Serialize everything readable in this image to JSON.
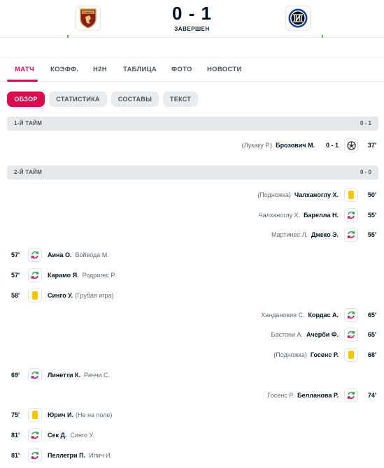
{
  "header": {
    "score": "0 - 1",
    "status": "ЗАВЕРШЕН",
    "home_logo_text": "TORINO"
  },
  "tabs": [
    {
      "label": "МАТЧ",
      "active": true
    },
    {
      "label": "КОЭФФ.",
      "active": false
    },
    {
      "label": "H2H",
      "active": false
    },
    {
      "label": "ТАБЛИЦА",
      "active": false
    },
    {
      "label": "ФОТО",
      "active": false
    },
    {
      "label": "НОВОСТИ",
      "active": false
    }
  ],
  "subtabs": [
    {
      "label": "ОБЗОР",
      "active": true
    },
    {
      "label": "СТАТИСТИКА",
      "active": false
    },
    {
      "label": "СОСТАВЫ",
      "active": false
    },
    {
      "label": "ТЕКСТ",
      "active": false
    }
  ],
  "sections": [
    {
      "title": "1-Й ТАЙМ",
      "score": "0 - 1"
    },
    {
      "title": "2-Й ТАЙМ",
      "score": "0 - 0"
    }
  ],
  "events": [
    {
      "side": "away",
      "minute": "37'",
      "type": "goal",
      "player": "Брозович М.",
      "secondary": "(Лукаку Р.)",
      "score": "0 - 1"
    },
    {
      "side": "away",
      "minute": "50'",
      "type": "yellow",
      "player": "Чалханоглу Х.",
      "secondary": "(Подножка)"
    },
    {
      "side": "away",
      "minute": "55'",
      "type": "sub",
      "player": "Барелла Н.",
      "secondary": "Чалханоглу Х."
    },
    {
      "side": "away",
      "minute": "55'",
      "type": "sub",
      "player": "Джеко Э.",
      "secondary": "Мартинес Л."
    },
    {
      "side": "home",
      "minute": "57'",
      "type": "sub",
      "player": "Аина О.",
      "secondary": "Войвода М."
    },
    {
      "side": "home",
      "minute": "57'",
      "type": "sub",
      "player": "Карамо Я.",
      "secondary": "Родригес Р."
    },
    {
      "side": "home",
      "minute": "58'",
      "type": "yellow",
      "player": "Синго У.",
      "secondary": "(Грубая игра)"
    },
    {
      "side": "away",
      "minute": "65'",
      "type": "sub",
      "player": "Кордас А.",
      "secondary": "Хандановия С."
    },
    {
      "side": "away",
      "minute": "65'",
      "type": "sub",
      "player": "Ачерби Ф.",
      "secondary": "Бастони А."
    },
    {
      "side": "away",
      "minute": "68'",
      "type": "yellow",
      "player": "Госенс Р.",
      "secondary": "(Подножка)"
    },
    {
      "side": "home",
      "minute": "69'",
      "type": "sub",
      "player": "Линетти К.",
      "secondary": "Риччи С."
    },
    {
      "side": "away",
      "minute": "74'",
      "type": "sub",
      "player": "Белланова Р.",
      "secondary": "Госенс Р."
    },
    {
      "side": "home",
      "minute": "75'",
      "type": "yellow",
      "player": "Юрич И.",
      "secondary": "(Не на поле)"
    },
    {
      "side": "home",
      "minute": "81'",
      "type": "sub",
      "player": "Сек Д.",
      "secondary": "Синго У."
    },
    {
      "side": "home",
      "minute": "81'",
      "type": "sub",
      "player": "Пеллегри П.",
      "secondary": "Илич И."
    }
  ],
  "colors": {
    "accent": "#dd0b4e",
    "yellow_card": "#f7c600",
    "sub_in": "#2fa84f",
    "sub_out": "#dd0b4e"
  }
}
